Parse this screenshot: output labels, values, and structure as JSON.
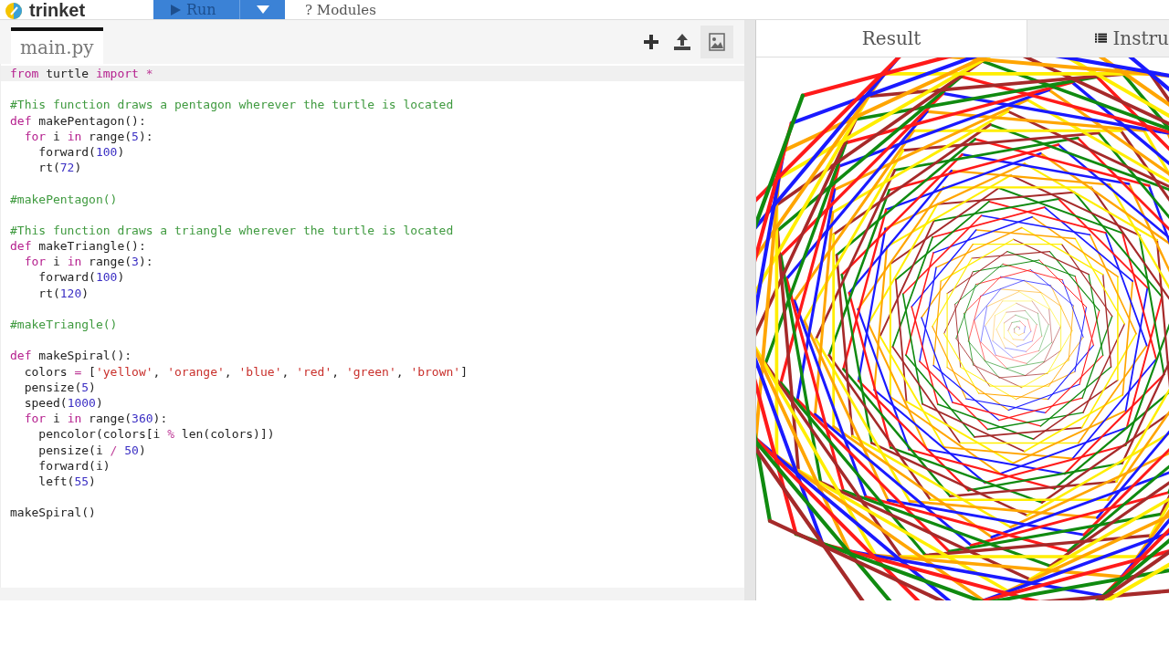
{
  "header": {
    "logo": "trinket",
    "run_button": "Run",
    "modules_link": "? Modules"
  },
  "editor": {
    "file_tab": {
      "label": "main.py",
      "selected": true
    },
    "lines": [
      {
        "active": true,
        "segments": [
          {
            "kind": "keyword",
            "text": "from"
          },
          {
            "kind": "plain",
            "text": " turtle "
          },
          {
            "kind": "keyword",
            "text": "import"
          },
          {
            "kind": "operator",
            "text": " *"
          }
        ]
      },
      {
        "active": false
      },
      {
        "active": false,
        "segments": [
          {
            "kind": "comment",
            "text": "#This function draws a pentagon wherever the turtle is located"
          }
        ]
      },
      {
        "active": false,
        "segments": [
          {
            "kind": "keyword",
            "text": "def"
          },
          {
            "kind": "plain",
            "text": " makePentagon():"
          }
        ]
      },
      {
        "active": false,
        "segments": [
          {
            "kind": "keyword",
            "text": "  for"
          },
          {
            "kind": "plain",
            "text": " i "
          },
          {
            "kind": "keyword",
            "text": "in"
          },
          {
            "kind": "plain",
            "text": " range("
          },
          {
            "kind": "number",
            "text": "5"
          },
          {
            "kind": "plain",
            "text": "):"
          }
        ]
      },
      {
        "active": false,
        "segments": [
          {
            "kind": "plain",
            "text": "    forward("
          },
          {
            "kind": "number",
            "text": "100"
          },
          {
            "kind": "plain",
            "text": ")"
          }
        ]
      },
      {
        "active": false,
        "segments": [
          {
            "kind": "plain",
            "text": "    rt("
          },
          {
            "kind": "number",
            "text": "72"
          },
          {
            "kind": "plain",
            "text": ")"
          }
        ]
      },
      {
        "active": false
      },
      {
        "active": false,
        "segments": [
          {
            "kind": "comment",
            "text": "#makePentagon()"
          }
        ]
      },
      {
        "active": false
      },
      {
        "active": false,
        "segments": [
          {
            "kind": "comment",
            "text": "#This function draws a triangle wherever the turtle is located"
          }
        ]
      },
      {
        "active": false,
        "segments": [
          {
            "kind": "keyword",
            "text": "def"
          },
          {
            "kind": "plain",
            "text": " makeTriangle():"
          }
        ]
      },
      {
        "active": false,
        "segments": [
          {
            "kind": "keyword",
            "text": "  for"
          },
          {
            "kind": "plain",
            "text": " i "
          },
          {
            "kind": "keyword",
            "text": "in"
          },
          {
            "kind": "plain",
            "text": " range("
          },
          {
            "kind": "number",
            "text": "3"
          },
          {
            "kind": "plain",
            "text": "):"
          }
        ]
      },
      {
        "active": false,
        "segments": [
          {
            "kind": "plain",
            "text": "    forward("
          },
          {
            "kind": "number",
            "text": "100"
          },
          {
            "kind": "plain",
            "text": ")"
          }
        ]
      },
      {
        "active": false,
        "segments": [
          {
            "kind": "plain",
            "text": "    rt("
          },
          {
            "kind": "number",
            "text": "120"
          },
          {
            "kind": "plain",
            "text": ")"
          }
        ]
      },
      {
        "active": false
      },
      {
        "active": false,
        "segments": [
          {
            "kind": "comment",
            "text": "#makeTriangle()"
          }
        ]
      },
      {
        "active": false
      },
      {
        "active": false,
        "segments": [
          {
            "kind": "keyword",
            "text": "def"
          },
          {
            "kind": "plain",
            "text": " makeSpiral():"
          }
        ]
      },
      {
        "active": false,
        "segments": [
          {
            "kind": "plain",
            "text": "  colors "
          },
          {
            "kind": "operator",
            "text": "="
          },
          {
            "kind": "plain",
            "text": " ["
          },
          {
            "kind": "string",
            "text": "'yellow'"
          },
          {
            "kind": "plain",
            "text": ", "
          },
          {
            "kind": "string",
            "text": "'orange'"
          },
          {
            "kind": "plain",
            "text": ", "
          },
          {
            "kind": "string",
            "text": "'blue'"
          },
          {
            "kind": "plain",
            "text": ", "
          },
          {
            "kind": "string",
            "text": "'red'"
          },
          {
            "kind": "plain",
            "text": ", "
          },
          {
            "kind": "string",
            "text": "'green'"
          },
          {
            "kind": "plain",
            "text": ", "
          },
          {
            "kind": "string",
            "text": "'brown'"
          },
          {
            "kind": "plain",
            "text": "]"
          }
        ]
      },
      {
        "active": false,
        "segments": [
          {
            "kind": "plain",
            "text": "  pensize("
          },
          {
            "kind": "number",
            "text": "5"
          },
          {
            "kind": "plain",
            "text": ")"
          }
        ]
      },
      {
        "active": false,
        "segments": [
          {
            "kind": "plain",
            "text": "  speed("
          },
          {
            "kind": "number",
            "text": "1000"
          },
          {
            "kind": "plain",
            "text": ")"
          }
        ]
      },
      {
        "active": false,
        "segments": [
          {
            "kind": "keyword",
            "text": "  for"
          },
          {
            "kind": "plain",
            "text": " i "
          },
          {
            "kind": "keyword",
            "text": "in"
          },
          {
            "kind": "plain",
            "text": " range("
          },
          {
            "kind": "number",
            "text": "360"
          },
          {
            "kind": "plain",
            "text": "):"
          }
        ]
      },
      {
        "active": false,
        "segments": [
          {
            "kind": "plain",
            "text": "    pencolor(colors[i "
          },
          {
            "kind": "operator",
            "text": "%"
          },
          {
            "kind": "plain",
            "text": " len(colors)])"
          }
        ]
      },
      {
        "active": false,
        "segments": [
          {
            "kind": "plain",
            "text": "    pensize(i "
          },
          {
            "kind": "operator",
            "text": "/"
          },
          {
            "kind": "number",
            "text": " 50"
          },
          {
            "kind": "plain",
            "text": ")"
          }
        ]
      },
      {
        "active": false,
        "segments": [
          {
            "kind": "plain",
            "text": "    forward(i)"
          }
        ]
      },
      {
        "active": false,
        "segments": [
          {
            "kind": "plain",
            "text": "    left("
          },
          {
            "kind": "number",
            "text": "55"
          },
          {
            "kind": "plain",
            "text": ")"
          }
        ]
      },
      {
        "active": false
      },
      {
        "active": false,
        "segments": [
          {
            "kind": "plain",
            "text": "makeSpiral()"
          }
        ]
      }
    ]
  },
  "output": {
    "tabs": [
      {
        "label": "Result",
        "selected": true
      },
      {
        "label": "Instru",
        "selected": false
      }
    ]
  }
}
